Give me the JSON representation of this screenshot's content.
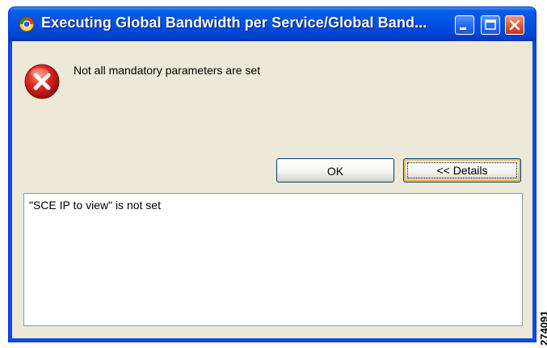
{
  "window": {
    "title": "Executing Global Bandwidth per Service/Global Band...",
    "controls": [
      "minimize-icon",
      "maximize-icon",
      "close-icon"
    ]
  },
  "dialog": {
    "icon": "error-icon",
    "message": "Not all mandatory parameters are set",
    "buttons": {
      "ok_label": "OK",
      "details_label": "<< Details"
    },
    "details_text": "\"SCE IP to view\" is not set"
  },
  "figure_code": "274091",
  "colors": {
    "titlebar": "#0052e4",
    "dialog_background": "#ece9d8",
    "close_button": "#e15a36",
    "error_icon": "#d21f1f"
  }
}
